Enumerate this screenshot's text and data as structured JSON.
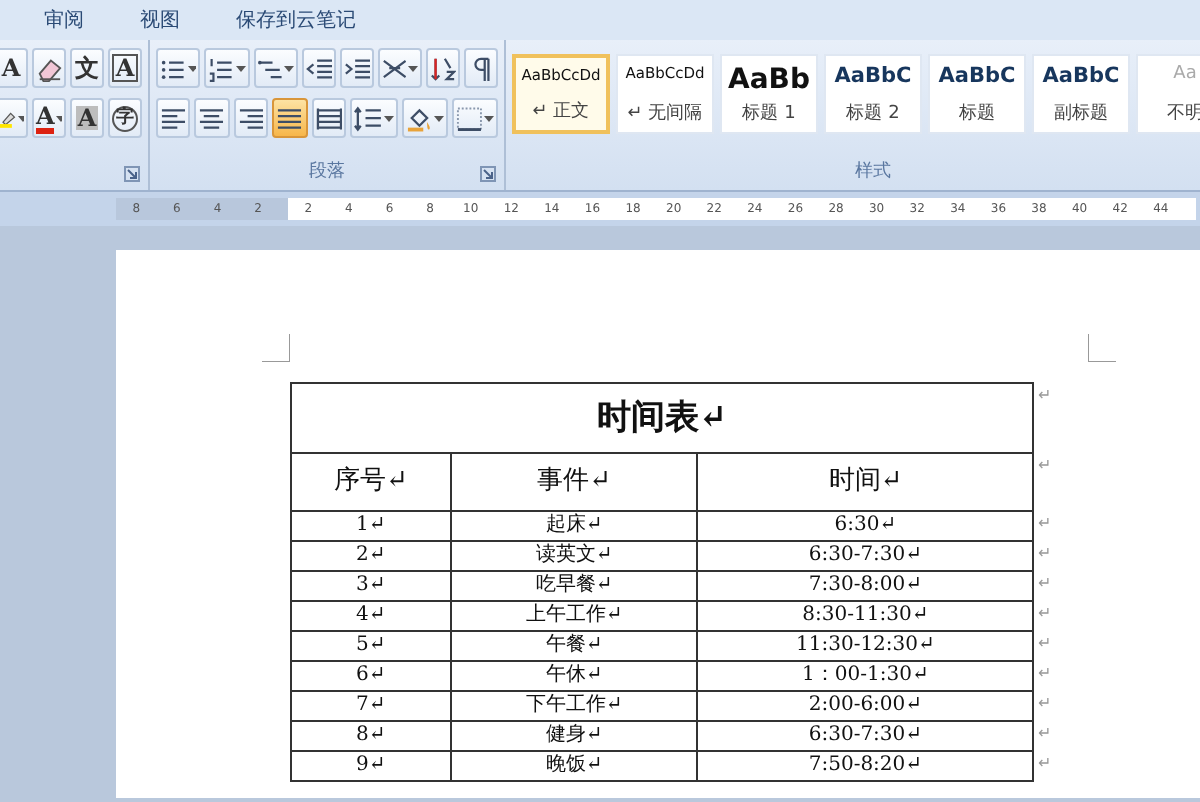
{
  "ribbon_tabs": [
    {
      "label": "审阅"
    },
    {
      "label": "视图"
    },
    {
      "label": "保存到云笔记"
    }
  ],
  "font_group": {
    "rows": [
      [
        {
          "kind": "text",
          "glyph": "A"
        },
        {
          "kind": "icon"
        },
        {
          "kind": "text",
          "glyph": "文"
        },
        {
          "kind": "text",
          "glyph": "A"
        }
      ],
      [
        {
          "kind": "icon"
        },
        {
          "kind": "text",
          "glyph": "A"
        },
        {
          "kind": "text",
          "glyph": "A"
        },
        {
          "kind": "text",
          "glyph": "字"
        }
      ]
    ]
  },
  "paragraph_group": {
    "label": "段落",
    "rows": [
      [
        {
          "dropdown": true,
          "selected": false
        },
        {
          "dropdown": true,
          "selected": false
        },
        {
          "dropdown": true,
          "selected": false
        },
        {
          "dropdown": false,
          "selected": false
        },
        {
          "dropdown": false,
          "selected": false
        },
        {
          "dropdown": true,
          "selected": false
        },
        {
          "dropdown": false,
          "selected": false
        },
        {
          "dropdown": false,
          "selected": false
        }
      ],
      [
        {
          "dropdown": false,
          "selected": false
        },
        {
          "dropdown": false,
          "selected": false
        },
        {
          "dropdown": false,
          "selected": false
        },
        {
          "dropdown": false,
          "selected": true
        },
        {
          "dropdown": false,
          "selected": false
        },
        {
          "dropdown": true,
          "selected": false
        },
        {
          "dropdown": true,
          "selected": false
        },
        {
          "dropdown": true,
          "selected": false
        }
      ]
    ]
  },
  "styles_group": {
    "label": "样式",
    "items": [
      {
        "sample": "AaBbCcDd",
        "label": "↵ 正文",
        "kind": "body",
        "selected": true
      },
      {
        "sample": "AaBbCcDd",
        "label": "↵ 无间隔",
        "kind": "body",
        "selected": false
      },
      {
        "sample": "AaBb",
        "label": "标题 1",
        "kind": "heading1",
        "selected": false
      },
      {
        "sample": "AaBbC",
        "label": "标题 2",
        "kind": "heading2",
        "selected": false
      },
      {
        "sample": "AaBbC",
        "label": "标题",
        "kind": "heading2",
        "selected": false
      },
      {
        "sample": "AaBbC",
        "label": "副标题",
        "kind": "heading2",
        "selected": false
      },
      {
        "sample": "Aa",
        "label": "不明",
        "kind": "subtle",
        "selected": false
      }
    ]
  },
  "ruler": {
    "left_ticks": [
      "8",
      "6",
      "4",
      "2"
    ],
    "right_ticks": [
      "2",
      "4",
      "6",
      "8",
      "10",
      "12",
      "14",
      "16",
      "18",
      "20",
      "22",
      "24",
      "26",
      "28",
      "30",
      "32",
      "34",
      "36",
      "38",
      "40",
      "42",
      "44"
    ]
  },
  "table": {
    "title": "时间表↵",
    "columns": [
      "序号↵",
      "事件↵",
      "时间↵"
    ],
    "rows": [
      [
        "1↵",
        "起床↵",
        "6:30↵"
      ],
      [
        "2↵",
        "读英文↵",
        "6:30-7:30↵"
      ],
      [
        "3↵",
        "吃早餐↵",
        "7:30-8:00↵"
      ],
      [
        "4↵",
        "上午工作↵",
        "8:30-11:30↵"
      ],
      [
        "5↵",
        "午餐↵",
        "11:30-12:30↵"
      ],
      [
        "6↵",
        "午休↵",
        "1：00-1:30↵"
      ],
      [
        "7↵",
        "下午工作↵",
        "2:00-6:00↵"
      ],
      [
        "8↵",
        "健身↵",
        "6:30-7:30↵"
      ],
      [
        "9↵",
        "晚饭↵",
        "7:50-8:20↵"
      ]
    ],
    "row_end_mark": "↵"
  }
}
